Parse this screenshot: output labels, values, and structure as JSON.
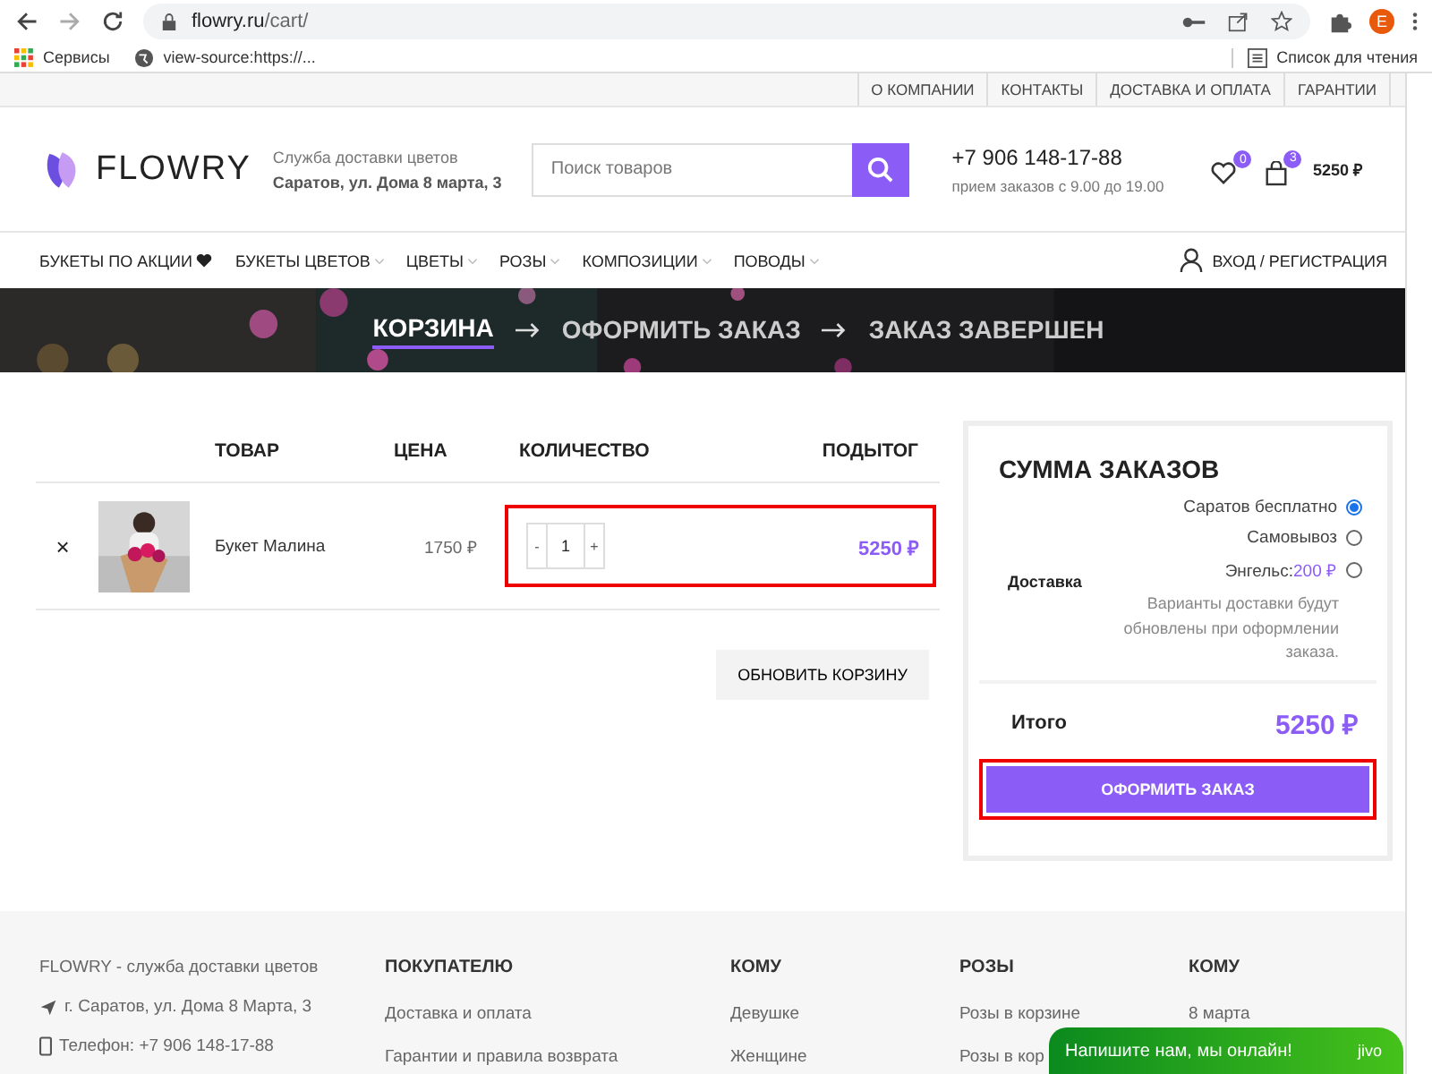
{
  "browser": {
    "url_host": "flowry.ru",
    "url_path": "/cart/",
    "profile_letter": "E",
    "bookmarks": [
      {
        "label": "Сервисы",
        "kind": "apps"
      },
      {
        "label": "view-source:https://...",
        "kind": "globe"
      }
    ],
    "reading_list": "Список для чтения"
  },
  "top_links": [
    "О КОМПАНИИ",
    "КОНТАКТЫ",
    "ДОСТАВКА И ОПЛАТА",
    "ГАРАНТИИ"
  ],
  "header": {
    "logo": "FLOWRY",
    "tagline": "Служба доставки цветов",
    "address": "Саратов, ул. Дома 8 марта, 3",
    "search": {
      "placeholder": "Поиск товаров"
    },
    "phone": "+7 906 148-17-88",
    "hours": "прием заказов с 9.00 до 19.00",
    "wishlist_count": "0",
    "cart_count": "3",
    "cart_total": "5250 ₽"
  },
  "nav": {
    "items": [
      {
        "label": "БУКЕТЫ ПО АКЦИИ",
        "heart": true,
        "dropdown": false
      },
      {
        "label": "БУКЕТЫ ЦВЕТОВ",
        "heart": false,
        "dropdown": true
      },
      {
        "label": "ЦВЕТЫ",
        "heart": false,
        "dropdown": true
      },
      {
        "label": "РОЗЫ",
        "heart": false,
        "dropdown": true
      },
      {
        "label": "КОМПОЗИЦИИ",
        "heart": false,
        "dropdown": true
      },
      {
        "label": "ПОВОДЫ",
        "heart": false,
        "dropdown": true
      }
    ],
    "login": "ВХОД / РЕГИСТРАЦИЯ"
  },
  "steps": [
    {
      "label": "КОРЗИНА",
      "selected": true
    },
    {
      "label": "ОФОРМИТЬ ЗАКАЗ",
      "selected": false
    },
    {
      "label": "ЗАКАЗ ЗАВЕРШЕН",
      "selected": false
    }
  ],
  "cart": {
    "columns": [
      "ТОВАР",
      "ЦЕНА",
      "КОЛИЧЕСТВО",
      "ПОДЫТОГ"
    ],
    "rows": [
      {
        "remove": "×",
        "product": "Букет Малина",
        "price": "1750 ₽",
        "minus": "-",
        "quantity": "1",
        "plus": "+",
        "subtotal": "5250 ₽"
      }
    ],
    "update_button": "ОБНОВИТЬ КОРЗИНУ"
  },
  "summary": {
    "title": "СУММА ЗАКАЗОВ",
    "shipping_label": "Доставка",
    "options": [
      {
        "label": "Саратов бесплатно",
        "selected": true
      },
      {
        "label": "Самовывоз",
        "selected": false
      },
      {
        "label": "Энгельс:",
        "price": "200 ₽",
        "selected": false
      }
    ],
    "note": "Варианты доставки будут обновлены при оформлении заказа.",
    "total_label": "Итого",
    "total": "5250 ₽",
    "checkout_button": "ОФОРМИТЬ ЗАКАЗ"
  },
  "footer": {
    "about": "FLOWRY - служба доставки цветов",
    "address": "г. Саратов, ул. Дома 8 Марта, 3",
    "phone": "Телефон: +7 906 148-17-88",
    "columns": [
      {
        "heading": "ПОКУПАТЕЛЮ",
        "links": [
          "Доставка и оплата",
          "Гарантии и правила возврата"
        ]
      },
      {
        "heading": "КОМУ",
        "links": [
          "Девушке",
          "Женщине"
        ]
      },
      {
        "heading": "РОЗЫ",
        "links": [
          "Розы в корзине",
          "Розы в кор"
        ]
      },
      {
        "heading": "КОМУ",
        "links": [
          "8 марта"
        ]
      }
    ]
  },
  "chat": {
    "text": "Напишите нам, мы онлайн!",
    "brand": "jivo"
  }
}
